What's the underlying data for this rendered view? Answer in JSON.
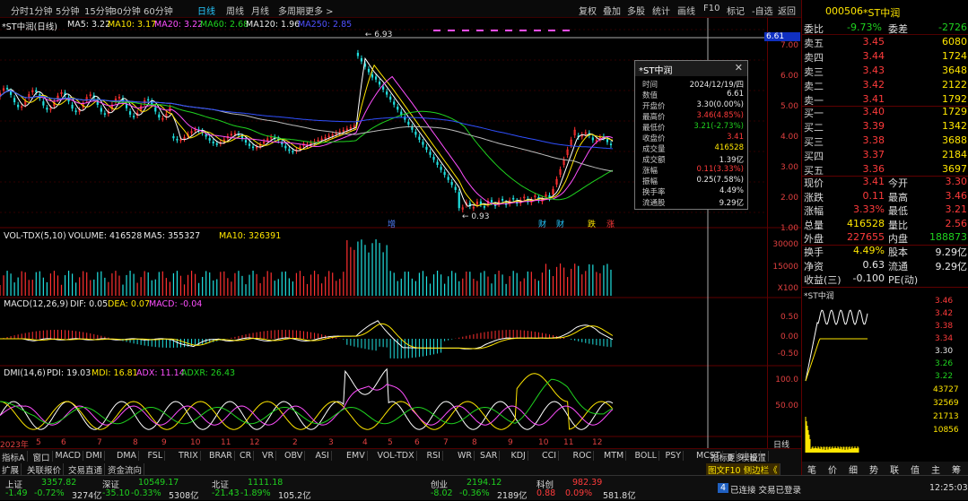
{
  "toolbar": {
    "periods": [
      "分时",
      "1分钟",
      "5分钟",
      "15分钟",
      "30分钟",
      "60分钟",
      "日线",
      "周线",
      "月线",
      "多周期",
      "更多 >"
    ],
    "right": [
      "复权",
      "叠加",
      "多股",
      "统计",
      "画线",
      "F10",
      "标记",
      "-自选",
      "返回"
    ]
  },
  "chart_title": "*ST中润(日线)",
  "ma_legend": {
    "ma5": "MA5: 3.22",
    "ma10": "MA10: 3.17",
    "ma20": "MA20: 3.22",
    "ma60": "MA60: 2.68",
    "ma120": "MA120: 1.96",
    "ma250": "MA250: 2.85"
  },
  "price_axis": [
    "7.00",
    "6.00",
    "5.00",
    "4.00",
    "3.00",
    "2.00",
    "1.00"
  ],
  "price_marker": "6.61",
  "annotations": {
    "high": "6.93",
    "low": "0.93",
    "tags": [
      "增",
      "财",
      "财",
      "跌",
      "涨"
    ]
  },
  "vol_legend": {
    "title": "VOL-TDX(5,10)",
    "volume": "VOLUME: 416528",
    "ma5": "MA5: 355327",
    "ma10": "MA10: 326391"
  },
  "vol_axis": [
    "30000",
    "15000",
    "X100"
  ],
  "macd_legend": {
    "title": "MACD(12,26,9)",
    "dif": "DIF: 0.05",
    "dea": "DEA: 0.07",
    "macd": "MACD: -0.04"
  },
  "macd_axis": [
    "0.50",
    "0.00",
    "-0.50"
  ],
  "dmi_legend": {
    "title": "DMI(14,6)",
    "pdi": "PDI: 19.03",
    "mdi": "MDI: 16.81",
    "adx": "ADX: 11.14",
    "adxr": "ADXR: 26.43"
  },
  "dmi_axis": [
    "100.0",
    "50.00"
  ],
  "months": [
    "2023年",
    "5",
    "6",
    "7",
    "8",
    "9",
    "10",
    "11",
    "12",
    "2",
    "3",
    "4",
    "5",
    "6",
    "7",
    "8",
    "9",
    "10",
    "11",
    "12",
    "日线"
  ],
  "tooltip": {
    "name": "*ST中润",
    "rows": [
      [
        "时间",
        "2024/12/19/四"
      ],
      [
        "数值",
        "6.61"
      ],
      [
        "开盘价",
        "3.30(0.00%)"
      ],
      [
        "最高价",
        "3.46(4.85%)"
      ],
      [
        "最低价",
        "3.21(-2.73%)"
      ],
      [
        "收盘价",
        "3.41"
      ],
      [
        "成交量",
        "416528"
      ],
      [
        "成交额",
        "1.39亿"
      ],
      [
        "涨幅",
        "0.11(3.33%)"
      ],
      [
        "振幅",
        "0.25(7.58%)"
      ],
      [
        "换手率",
        "4.49%"
      ],
      [
        "流通股",
        "9.29亿"
      ]
    ]
  },
  "side": {
    "code": "000506",
    "name": "*ST中润",
    "wb_label": "委比",
    "wb": "-9.73%",
    "wc_label": "委差",
    "wc": "-2726",
    "sells": [
      [
        "卖五",
        "3.45",
        "6080"
      ],
      [
        "卖四",
        "3.44",
        "1724"
      ],
      [
        "卖三",
        "3.43",
        "3648"
      ],
      [
        "卖二",
        "3.42",
        "2122"
      ],
      [
        "卖一",
        "3.41",
        "1792"
      ]
    ],
    "buys": [
      [
        "买一",
        "3.40",
        "1729"
      ],
      [
        "买二",
        "3.39",
        "1342"
      ],
      [
        "买三",
        "3.38",
        "3688"
      ],
      [
        "买四",
        "3.37",
        "2184"
      ],
      [
        "买五",
        "3.36",
        "3697"
      ]
    ],
    "quote": [
      [
        "现价",
        "3.41",
        "今开",
        "3.30"
      ],
      [
        "涨跌",
        "0.11",
        "最高",
        "3.46"
      ],
      [
        "涨幅",
        "3.33%",
        "最低",
        "3.21"
      ],
      [
        "总量",
        "416528",
        "量比",
        "2.56"
      ],
      [
        "外盘",
        "227655",
        "内盘",
        "188873"
      ]
    ],
    "quote2": [
      [
        "换手",
        "4.49%",
        "股本",
        "9.29亿"
      ],
      [
        "净资",
        "0.63",
        "流通",
        "9.29亿"
      ],
      [
        "收益(三)",
        "-0.100",
        "PE(动)",
        ""
      ]
    ],
    "mini_title": "*ST中润",
    "mini_price": [
      "3.46",
      "3.42",
      "3.38",
      "3.34",
      "3.30",
      "3.26",
      "3.22"
    ],
    "mini_vol": [
      "43727",
      "32569",
      "21713",
      "10856"
    ],
    "tabs": [
      "笔",
      "价",
      "细",
      "势",
      "联",
      "值",
      "主",
      "筹"
    ]
  },
  "bottom_tabs": [
    "指标A",
    "窗口",
    "MACD",
    "DMI",
    "DMA",
    "FSL",
    "TRIX",
    "BRAR",
    "CR",
    "VR",
    "OBV",
    "ASI",
    "EMV",
    "VOL-TDX",
    "RSI",
    "WR",
    "SAR",
    "KDJ",
    "CCI",
    "ROC",
    "MTM",
    "BOLL",
    "PSY",
    "MCST",
    "更多",
    "设置"
  ],
  "right_tabs": [
    "指标B",
    "模板"
  ],
  "nav_tabs": [
    "扩展",
    "关联报价",
    "交易直通",
    "资金流向"
  ],
  "nav_right": "图文F10 侧边栏《",
  "status": {
    "items": [
      [
        "上证",
        "3357.82",
        "-1.49",
        "-0.72%",
        "3274亿"
      ],
      [
        "深证",
        "10549.17",
        "-35.10",
        "-0.33%",
        "5308亿"
      ],
      [
        "北证",
        "1111.18",
        "-21.43",
        "-1.89%",
        "105.2亿"
      ],
      [
        "创业",
        "2194.12",
        "-8.02",
        "-0.36%",
        "2189亿"
      ],
      [
        "科创",
        "982.39",
        "0.88",
        "0.09%",
        "581.8亿"
      ]
    ],
    "conn": "已连接 交易已登录",
    "badge": "4",
    "time": "12:25:03"
  }
}
